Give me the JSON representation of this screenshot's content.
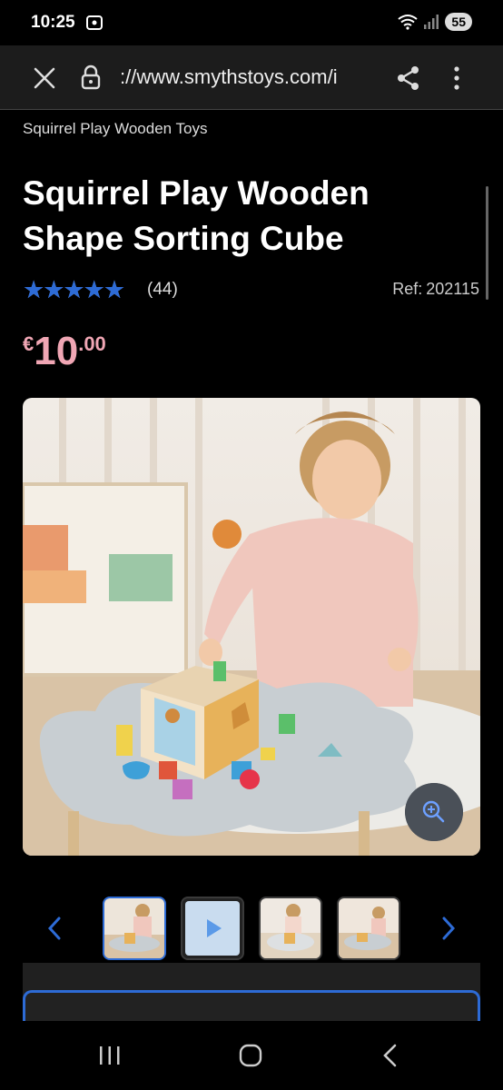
{
  "status": {
    "time": "10:25",
    "battery": "55"
  },
  "browser": {
    "url": "://www.smythstoys.com/i"
  },
  "product": {
    "brand": "Squirrel Play Wooden Toys",
    "title": "Squirrel Play Wooden Shape Sorting Cube",
    "rating": 4.8,
    "rating_stars": "★★★★★",
    "review_count": "(44)",
    "ref_label": "Ref:",
    "ref_value": "202115",
    "price": {
      "currency": "€",
      "main": "10",
      "cents": ".00"
    }
  },
  "gallery": {
    "thumbnails": [
      {
        "kind": "image",
        "active": true
      },
      {
        "kind": "video",
        "active": false
      },
      {
        "kind": "image",
        "active": false
      },
      {
        "kind": "image",
        "active": false
      }
    ]
  },
  "colors": {
    "accent": "#2d6bd6",
    "price": "#f0a6b4",
    "background": "#000000"
  }
}
